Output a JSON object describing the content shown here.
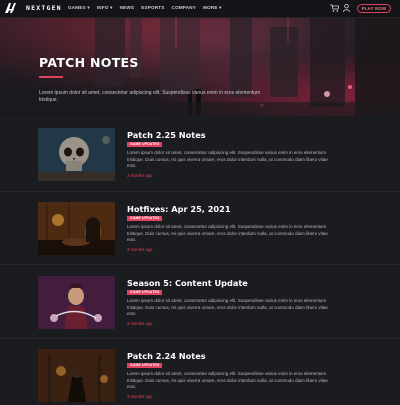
{
  "nav": {
    "brand": "NEXTGEN",
    "menu": [
      "GAMES ▾",
      "INFO ▾",
      "NEWS",
      "ESPORTS",
      "COMPANY",
      "MORE ▾"
    ],
    "play_label": "PLAY NOW",
    "accent": "#e0415c"
  },
  "hero": {
    "title": "PATCH NOTES",
    "text": "Lorem ipsum dolor sit amet, consectetur adipiscing elit. Suspendisse varius enim in eros elementum tristique."
  },
  "articles": [
    {
      "title": "Patch 2.25 Notes",
      "tag": "GAME UPDATES",
      "body": "Lorem ipsum dolor sit amet, consectetur adipiscing elit. Suspendisse varius enim in eros elementum tristique. Duis cursus, mi quis viverra ornare, eros dolor interdum nulla, ut commodo diam libero vitae erat.",
      "time": "3 months ago"
    },
    {
      "title": "Hotfixes: Apr 25, 2021",
      "tag": "GAME UPDATES",
      "body": "Lorem ipsum dolor sit amet, consectetur adipiscing elit. Suspendisse varius enim in eros elementum tristique. Duis cursus, mi quis viverra ornare, eros dolor interdum nulla, ut commodo diam libero vitae erat.",
      "time": "3 months ago"
    },
    {
      "title": "Season 5: Content Update",
      "tag": "GAME UPDATES",
      "body": "Lorem ipsum dolor sit amet, consectetur adipiscing elit. Suspendisse varius enim in eros elementum tristique. Duis cursus, mi quis viverra ornare, eros dolor interdum nulla, ut commodo diam libero vitae erat.",
      "time": "3 months ago"
    },
    {
      "title": "Patch 2.24 Notes",
      "tag": "GAME UPDATES",
      "body": "Lorem ipsum dolor sit amet, consectetur adipiscing elit. Suspendisse varius enim in eros elementum tristique. Duis cursus, mi quis viverra ornare, eros dolor interdum nulla, ut commodo diam libero vitae erat.",
      "time": "3 months ago"
    }
  ]
}
